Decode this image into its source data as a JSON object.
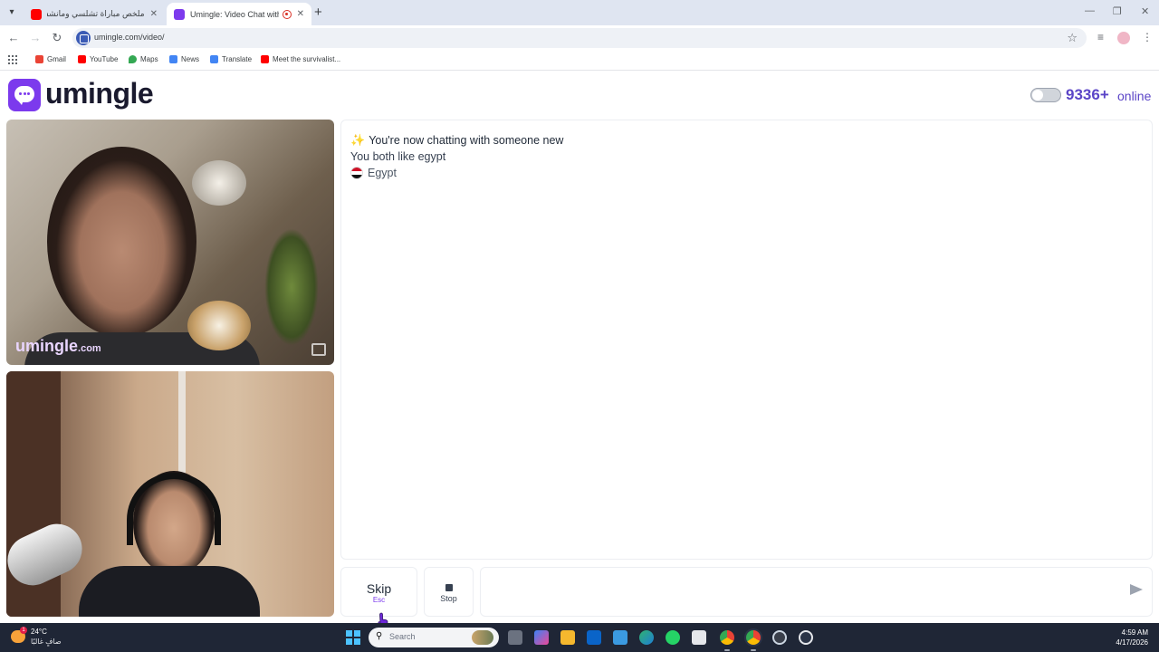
{
  "browser": {
    "tabs": [
      {
        "title": "ملخص مباراة تشلسي ومانشستر ...",
        "favicon_color": "#ff0000",
        "active": false
      },
      {
        "title": "Umingle: Video Chat with St",
        "favicon_color": "#7c3aed",
        "active": true
      }
    ],
    "address": "umingle.com/video/",
    "bookmarks": [
      {
        "label": "Gmail",
        "icon": "gmail-icon",
        "color": "#ea4335"
      },
      {
        "label": "YouTube",
        "icon": "youtube-icon",
        "color": "#ff0000"
      },
      {
        "label": "Maps",
        "icon": "maps-icon",
        "color": "#34a853"
      },
      {
        "label": "News",
        "icon": "news-icon",
        "color": "#4285f4"
      },
      {
        "label": "Translate",
        "icon": "translate-icon",
        "color": "#4285f4"
      },
      {
        "label": "Meet the survivalist...",
        "icon": "youtube-icon",
        "color": "#ff0000"
      }
    ]
  },
  "site": {
    "brand": "umingle",
    "accent": "#7c3aed",
    "online_count": "9336+",
    "online_label": "online"
  },
  "videos": {
    "remote_watermark": "umingle",
    "remote_watermark_domain": ".com"
  },
  "chat": {
    "title": "You're now chatting with someone new",
    "shared_interest": "You both like egypt",
    "country": "Egypt"
  },
  "controls": {
    "skip_label": "Skip",
    "skip_key": "Esc",
    "stop_label": "Stop",
    "input_placeholder": ""
  },
  "taskbar": {
    "weather_badge": "1",
    "temperature": "24°C",
    "weather_desc": "صافٍ غالبًا",
    "search_placeholder": "Search",
    "time": "4:59 AM",
    "date": "4/17/2026"
  }
}
